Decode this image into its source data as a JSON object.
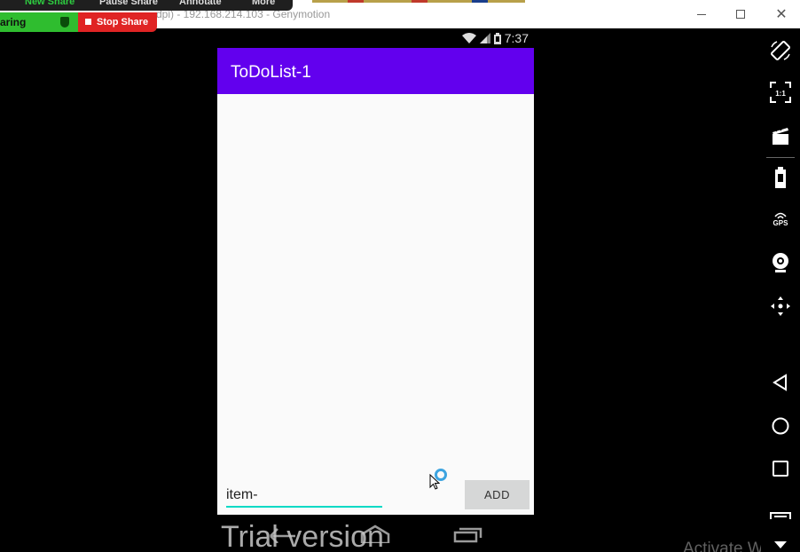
{
  "window": {
    "title": "dpi) - 192.168.214.103 - Genymotion"
  },
  "zoom": {
    "items": [
      "New Share",
      "Pause Share",
      "Annotate",
      "More"
    ],
    "sharing_label": "aring",
    "stop_label": "Stop Share"
  },
  "status_bar": {
    "time": "7:37"
  },
  "app": {
    "title": "ToDoList-1",
    "input_value": "item-",
    "add_label": "ADD"
  },
  "watermark": {
    "trial": "Trial version",
    "activate": "Activate Windo"
  },
  "sidebar": {
    "icons": [
      "rotate-icon",
      "pixel-perfect-icon",
      "screen-capture-icon",
      "battery-icon",
      "gps-icon",
      "camera-icon",
      "dpad-icon",
      "back-icon",
      "home-icon",
      "recents-icon",
      "menu-icon"
    ],
    "gps_label": "GPS",
    "pixel_label": "1:1"
  },
  "colors": {
    "app_bar": "#6200ee",
    "accent": "#03dac5",
    "content_bg": "#fafafa"
  }
}
